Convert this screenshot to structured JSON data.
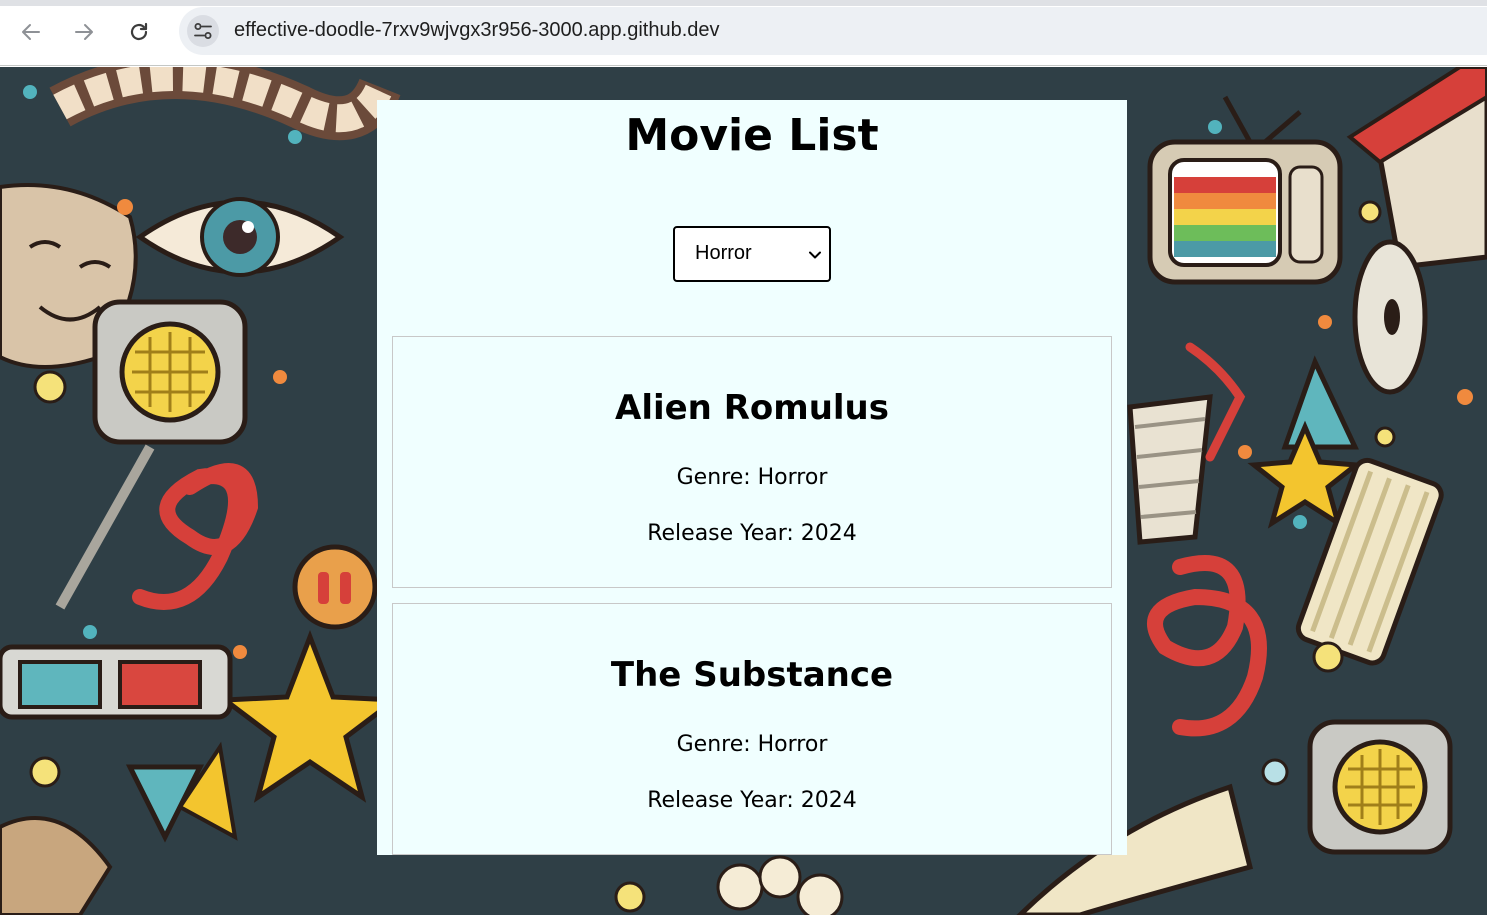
{
  "browser": {
    "url": "effective-doodle-7rxv9wjvgx3r956-3000.app.github.dev"
  },
  "page": {
    "title": "Movie List",
    "genre_filter": {
      "selected": "Horror"
    },
    "movies": [
      {
        "title": "Alien Romulus",
        "genre_line": "Genre: Horror",
        "year_line": "Release Year: 2024"
      },
      {
        "title": "The Substance",
        "genre_line": "Genre: Horror",
        "year_line": "Release Year: 2024"
      }
    ]
  },
  "colors": {
    "panel_background": "#f0ffff",
    "page_background": "#2e3d44",
    "text": "#000000",
    "card_border": "#c8c8c8"
  },
  "icons": [
    "back-arrow-icon",
    "forward-arrow-icon",
    "reload-icon",
    "site-info-icon",
    "chevron-down-icon"
  ]
}
